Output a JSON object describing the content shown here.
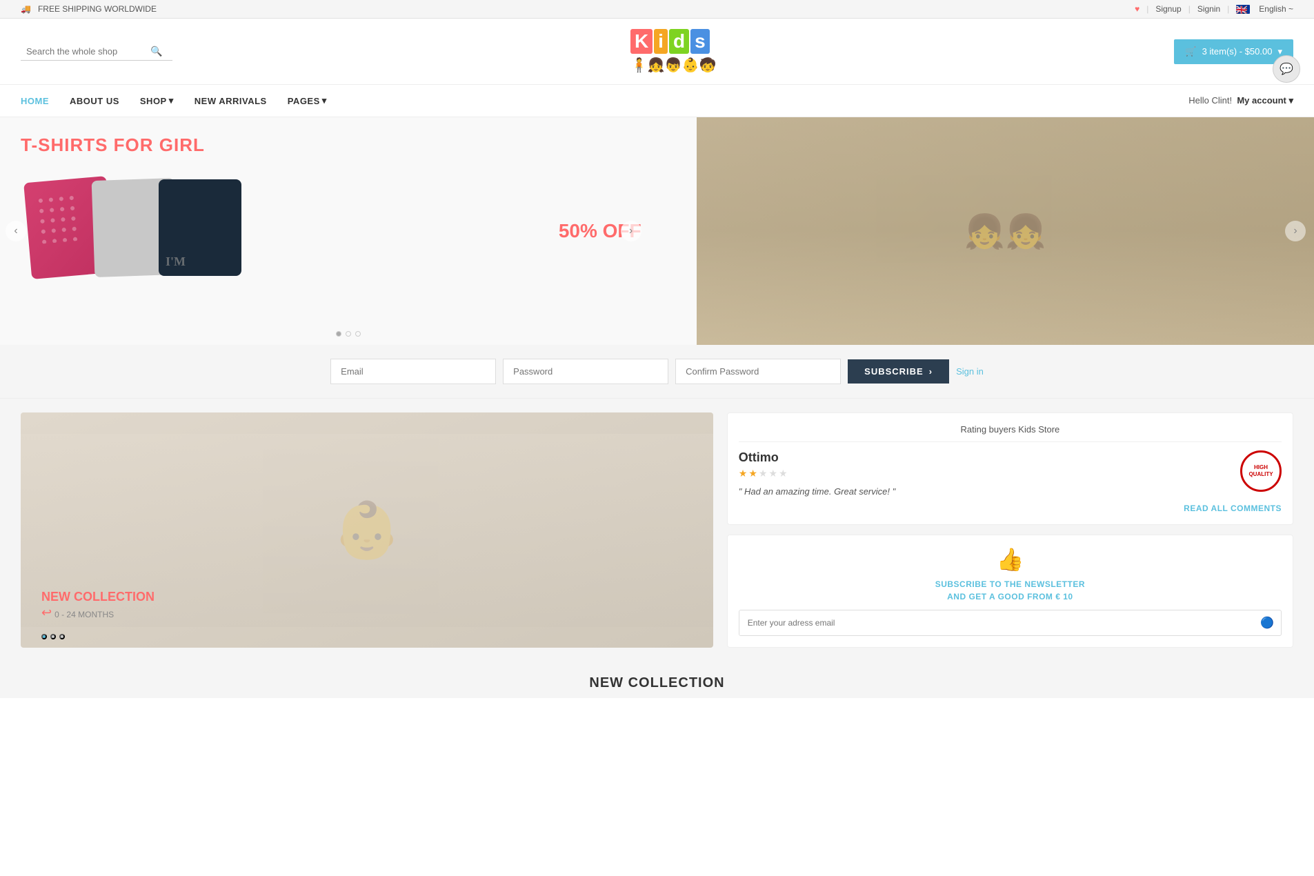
{
  "topbar": {
    "shipping": "FREE SHIPPING WORLDWIDE",
    "signup": "Signup",
    "signin": "Signin",
    "language": "English ~"
  },
  "header": {
    "search_placeholder": "Search the whole shop",
    "logo": {
      "letters": [
        "K",
        "i",
        "d",
        "s"
      ],
      "figures": [
        "🧍",
        "👧",
        "👦",
        "👶",
        "🧒"
      ]
    },
    "cart": {
      "label": "3 item(s) - $50.00",
      "dropdown": "▾"
    }
  },
  "nav": {
    "items": [
      {
        "label": "HOME",
        "active": true
      },
      {
        "label": "ABOUT US",
        "active": false
      },
      {
        "label": "SHOP",
        "active": false,
        "has_dropdown": true
      },
      {
        "label": "NEW ARRIVALS",
        "active": false
      },
      {
        "label": "PAGES",
        "active": false,
        "has_dropdown": true
      }
    ],
    "account_greeting": "Hello Clint!",
    "account_label": "My account ▾"
  },
  "hero": {
    "left": {
      "title": "T-SHIRTS FOR GIRL",
      "discount": "50% OFF",
      "prev_label": "‹",
      "next_label": "›",
      "dots": [
        true,
        false,
        false
      ]
    },
    "right": {
      "next_label": "›"
    }
  },
  "subscribe_bar": {
    "email_placeholder": "Email",
    "password_placeholder": "Password",
    "confirm_placeholder": "Confirm Password",
    "button_label": "SUBSCRIBE",
    "button_arrow": "›",
    "signin_label": "Sign in"
  },
  "main": {
    "new_collection": {
      "title": "NEW COLLECTION",
      "subtitle": "0 - 24 MONTHS",
      "arrow": "↩",
      "dots": [
        true,
        false,
        false
      ]
    },
    "review": {
      "section_title": "Rating buyers Kids Store",
      "reviewer_name": "Ottimo",
      "stars": [
        true,
        true,
        false,
        false,
        false
      ],
      "quote": "Had an amazing time. Great service!",
      "badge_text": "HIGH\nQUALITY",
      "read_all": "READ ALL COMMENTS"
    },
    "newsletter": {
      "icon": "👍",
      "title_line1": "SUBSCRIBE TO THE NEWSLETTER",
      "title_line2": "AND GET A GOOD FROM € 10",
      "email_placeholder": "Enter your adress email"
    }
  },
  "bottom_section": {
    "title": "NEW COLLECTION"
  }
}
